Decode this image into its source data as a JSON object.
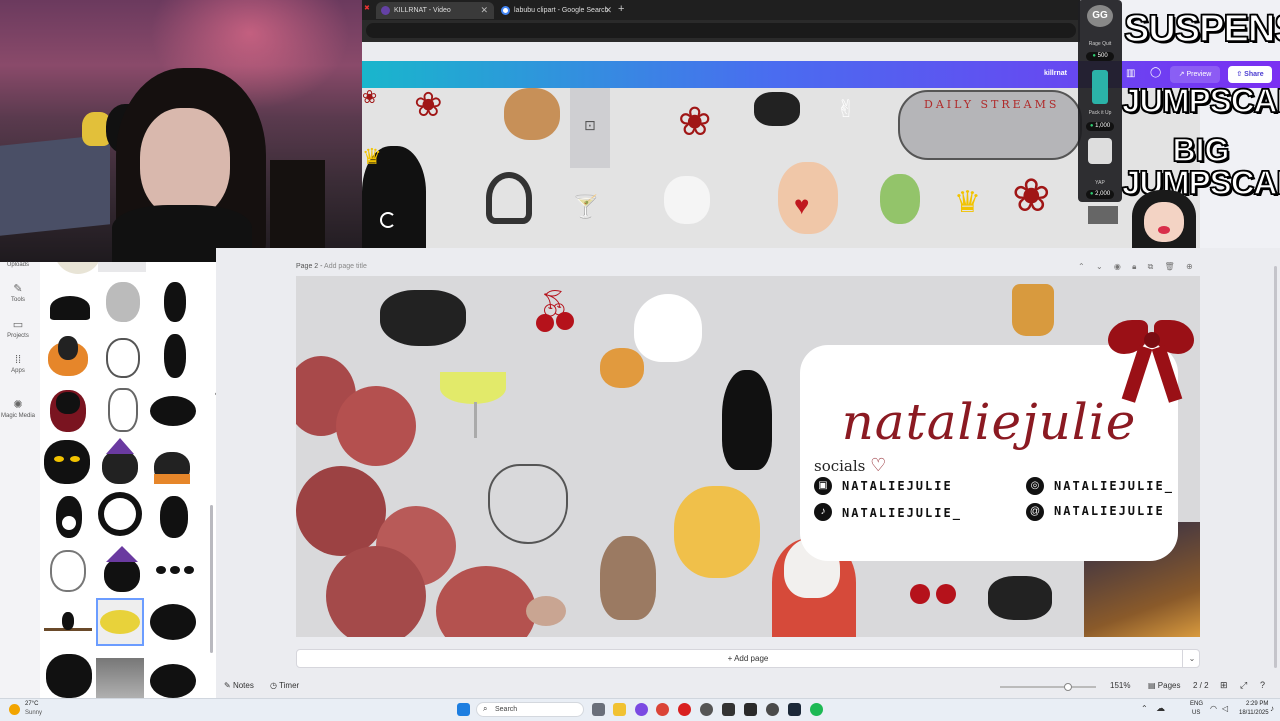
{
  "browser": {
    "tabs": [
      {
        "title": "KILLRNAT - Video",
        "active": true
      },
      {
        "title": "labubu clipart - Google Search",
        "active": false
      }
    ],
    "new_tab_label": "+"
  },
  "canva_header": {
    "user": "killrnat",
    "preview_label": "Preview",
    "share_label": "Share"
  },
  "top_canvas": {
    "headline": "DAILY STREAMS"
  },
  "editor": {
    "page_label": "Page 2",
    "page_title_placeholder": "Add page title",
    "add_page_label": "+ Add page"
  },
  "design": {
    "name": "nataliejulie",
    "socials_label": "socials",
    "socials": [
      {
        "platform": "twitch-icon",
        "handle": "NATALIEJULIE"
      },
      {
        "platform": "tiktok-icon",
        "handle": "NATALIEJULIE_"
      },
      {
        "platform": "instagram-icon",
        "handle": "NATALIEJULIE_"
      },
      {
        "platform": "threads-icon",
        "handle": "NATALIEJULIE"
      }
    ]
  },
  "left_sidebar": {
    "items": [
      {
        "label": "Uploads",
        "icon": "upload-icon"
      },
      {
        "label": "Tools",
        "icon": "pen-icon"
      },
      {
        "label": "Projects",
        "icon": "folder-icon"
      },
      {
        "label": "Apps",
        "icon": "apps-icon"
      },
      {
        "label": "Magic Media",
        "icon": "magic-icon"
      }
    ]
  },
  "bottom_bar": {
    "notes_label": "Notes",
    "timer_label": "Timer",
    "zoom": "151%",
    "pages_label": "Pages",
    "page_count": "2 / 2"
  },
  "stream_overlay": {
    "suspense": "SUSPENSE",
    "jumpscare": "JUMPSCARE",
    "big_jumpscare_line1": "BIG",
    "big_jumpscare_line2": "JUMPSCARE",
    "redeem_badge": "GG",
    "redeems": [
      {
        "name": "Rage Quit",
        "cost": "500"
      },
      {
        "name": "Pack it Up",
        "cost": "1,000"
      },
      {
        "name": "YAP",
        "cost": "2,000"
      }
    ]
  },
  "taskbar": {
    "weather_temp": "27°C",
    "weather_desc": "Sunny",
    "search_label": "Search",
    "lang_line1": "ENG",
    "lang_line2": "US",
    "time": "2:29 PM",
    "date": "18/11/2025"
  },
  "colors": {
    "brand_gradient_start": "#19b6cc",
    "brand_gradient_end": "#7b2ff2",
    "title_red": "#8b1a22"
  }
}
